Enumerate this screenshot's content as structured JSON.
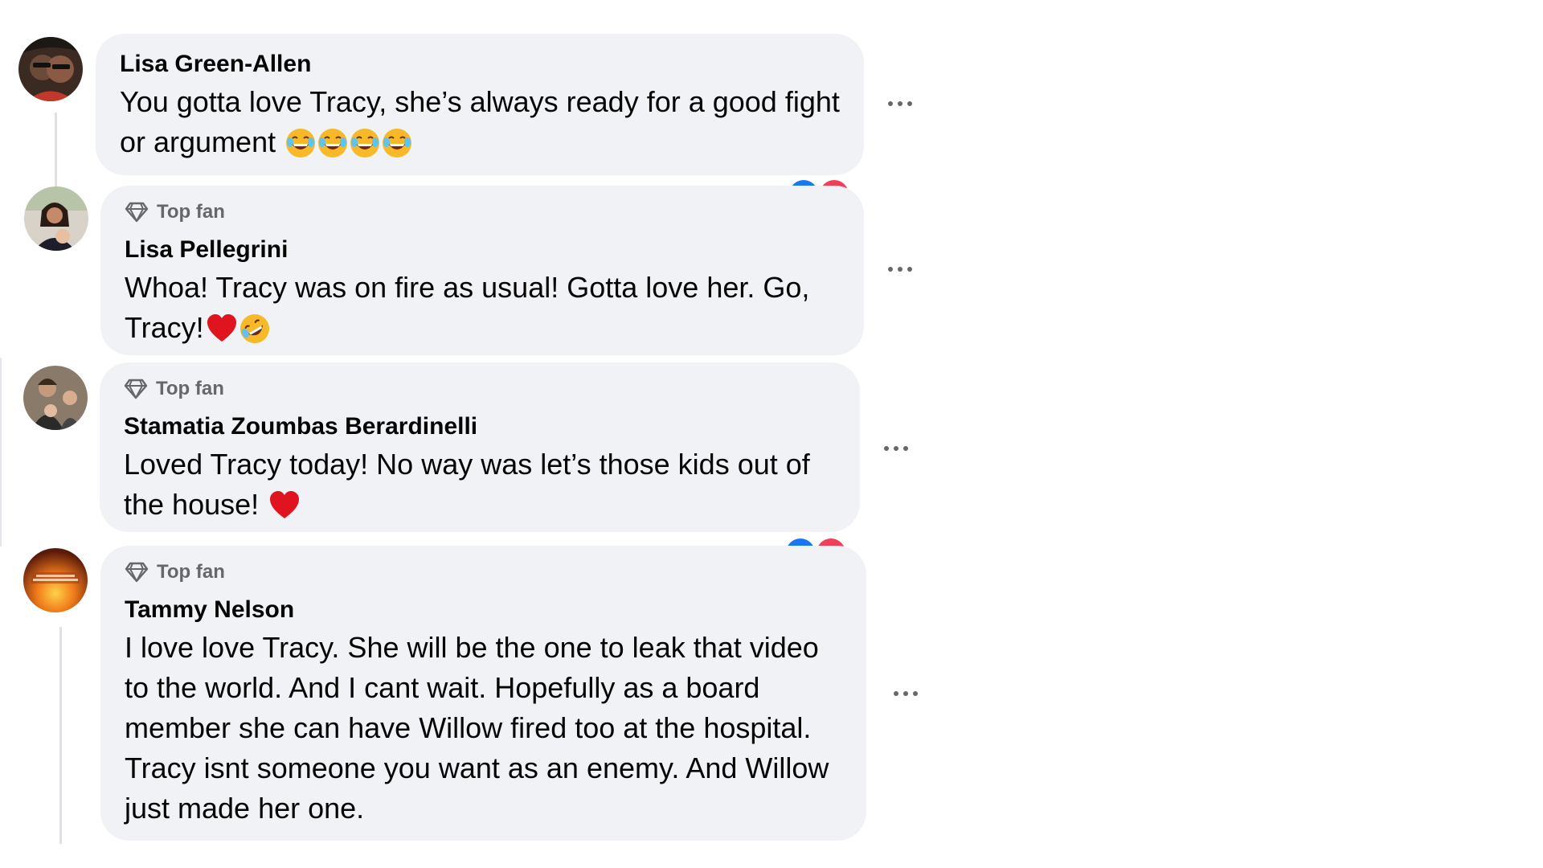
{
  "comments": [
    {
      "author": "Lisa Green-Allen",
      "top_fan": false,
      "text": "You gotta love Tracy, she’s always ready for a good fight or argument",
      "emojis": [
        "laughing-emoji",
        "laughing-emoji",
        "laughing-emoji",
        "laughing-emoji"
      ]
    },
    {
      "author": "Lisa Pellegrini",
      "top_fan": true,
      "badge_label": "Top fan",
      "text": "Whoa! Tracy was on fire as usual! Gotta love her. Go, Tracy!",
      "emojis": [
        "heart-emoji",
        "rofl-emoji"
      ]
    },
    {
      "author": "Stamatia Zoumbas Berardinelli",
      "top_fan": true,
      "badge_label": "Top fan",
      "text": "Loved Tracy today! No way was let’s those kids out of the house!",
      "emojis": [
        "heart-emoji"
      ]
    },
    {
      "author": "Tammy Nelson",
      "top_fan": true,
      "badge_label": "Top fan",
      "text": "I love love Tracy. She will be the one to leak that video to the world. And I cant wait. Hopefully as a board member she can have Willow fired too at the hospital. Tracy isnt someone you want as an enemy. And Willow just made her one."
    }
  ],
  "colors": {
    "bubble": "#f0f2f5",
    "secondary_text": "#65676b",
    "primary_text": "#050505",
    "thread_line": "#dfe1e5",
    "like_blue": "#1877f2",
    "love_red": "#f33e58"
  },
  "icons": {
    "more": "more-options-icon",
    "badge": "diamond-icon"
  }
}
